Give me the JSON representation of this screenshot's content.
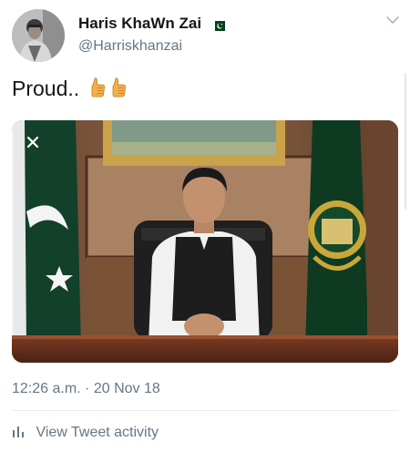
{
  "user": {
    "name": "Haris KhaWn Zai",
    "handle": "@Harriskhanzai",
    "flag_icon": "pakistan-flag-icon"
  },
  "tweet": {
    "text": "Proud..",
    "emojis": [
      "thumbs-up-emoji",
      "thumbs-up-emoji"
    ],
    "timestamp": "12:26 a.m. · 20 Nov 18"
  },
  "media": {
    "close_icon": "close-icon"
  },
  "footer": {
    "activity_label": "View Tweet activity",
    "activity_icon": "bar-chart-icon"
  },
  "colors": {
    "text": "#14171a",
    "secondary": "#657786",
    "flag_green": "#01411c",
    "divider": "#e6ecf0"
  }
}
